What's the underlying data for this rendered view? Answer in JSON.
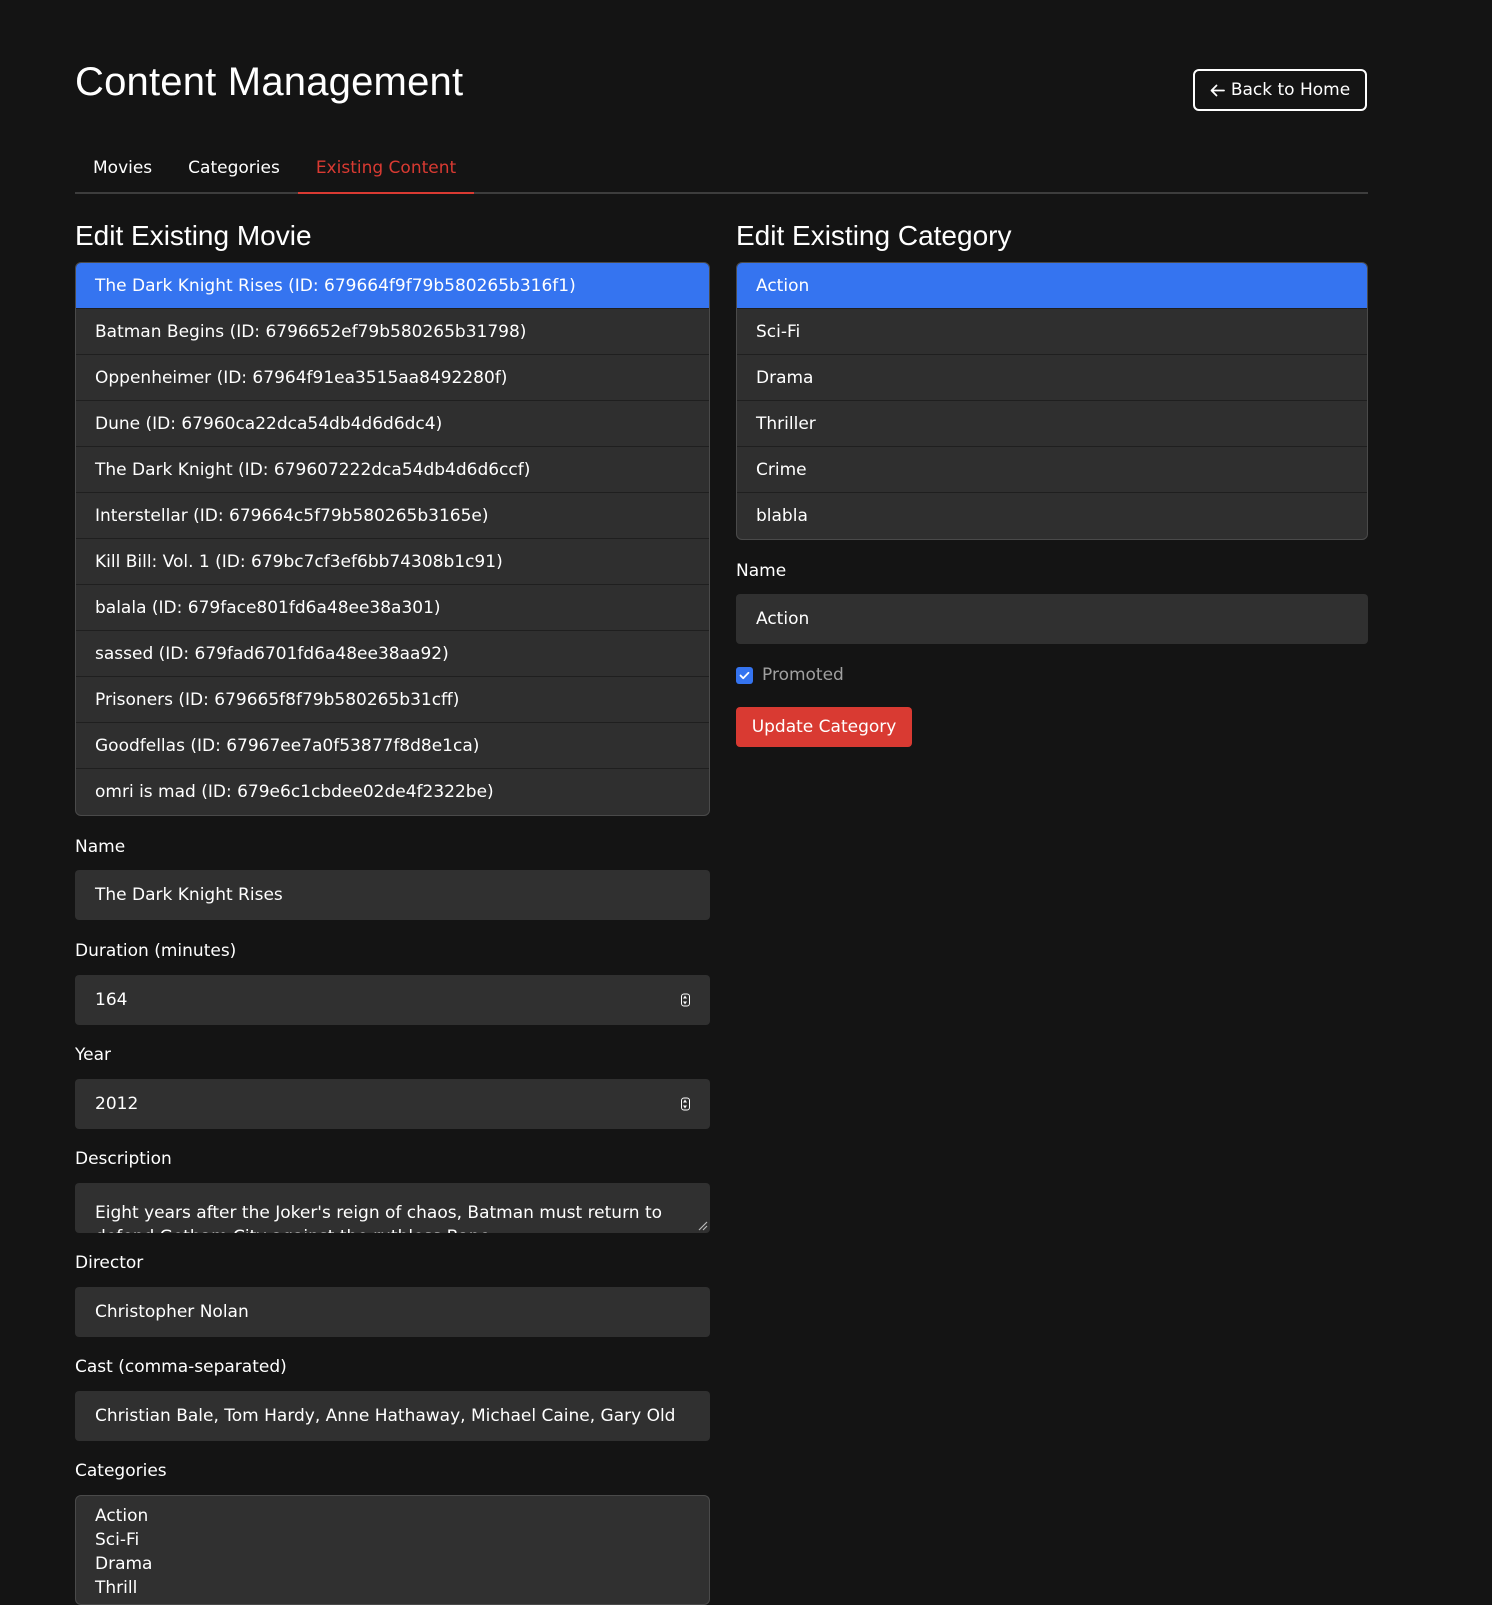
{
  "header": {
    "title": "Content Management",
    "back_label": "Back to Home",
    "back_icon": "arrow-left-icon"
  },
  "tabs": [
    {
      "label": "Movies",
      "active": false
    },
    {
      "label": "Categories",
      "active": false
    },
    {
      "label": "Existing Content",
      "active": true
    }
  ],
  "movie_editor": {
    "title": "Edit Existing Movie",
    "movies": [
      {
        "label": "The Dark Knight Rises (ID: 679664f9f79b580265b316f1)",
        "selected": true
      },
      {
        "label": "Batman Begins (ID: 6796652ef79b580265b31798)",
        "selected": false
      },
      {
        "label": "Oppenheimer (ID: 67964f91ea3515aa8492280f)",
        "selected": false
      },
      {
        "label": "Dune (ID: 67960ca22dca54db4d6d6dc4)",
        "selected": false
      },
      {
        "label": "The Dark Knight (ID: 679607222dca54db4d6d6ccf)",
        "selected": false
      },
      {
        "label": "Interstellar (ID: 679664c5f79b580265b3165e)",
        "selected": false
      },
      {
        "label": "Kill Bill: Vol. 1 (ID: 679bc7cf3ef6bb74308b1c91)",
        "selected": false
      },
      {
        "label": "balala (ID: 679face801fd6a48ee38a301)",
        "selected": false
      },
      {
        "label": "sassed (ID: 679fad6701fd6a48ee38aa92)",
        "selected": false
      },
      {
        "label": "Prisoners (ID: 679665f8f79b580265b31cff)",
        "selected": false
      },
      {
        "label": "Goodfellas (ID: 67967ee7a0f53877f8d8e1ca)",
        "selected": false
      },
      {
        "label": "omri is mad (ID: 679e6c1cbdee02de4f2322be)",
        "selected": false
      }
    ],
    "name_label": "Name",
    "name_value": "The Dark Knight Rises",
    "duration_label": "Duration (minutes)",
    "duration_value": "164",
    "year_label": "Year",
    "year_value": "2012",
    "description_label": "Description",
    "description_value": "Eight years after the Joker's reign of chaos, Batman must return to defend Gotham City against the ruthless Bane.",
    "director_label": "Director",
    "director_value": "Christopher Nolan",
    "cast_label": "Cast (comma-separated)",
    "cast_value": "Christian Bale, Tom Hardy, Anne Hathaway, Michael Caine, Gary Old",
    "categories_label": "Categories",
    "categories_options": [
      "Action",
      "Sci-Fi",
      "Drama",
      "Thrill"
    ]
  },
  "category_editor": {
    "title": "Edit Existing Category",
    "categories": [
      {
        "label": "Action",
        "selected": true
      },
      {
        "label": "Sci-Fi",
        "selected": false
      },
      {
        "label": "Drama",
        "selected": false
      },
      {
        "label": "Thriller",
        "selected": false
      },
      {
        "label": "Crime",
        "selected": false
      },
      {
        "label": "blabla",
        "selected": false
      }
    ],
    "name_label": "Name",
    "name_value": "Action",
    "promoted_label": "Promoted",
    "promoted_checked": true,
    "update_label": "Update Category"
  },
  "colors": {
    "background": "#141414",
    "accent_blue": "#3574f0",
    "accent_red": "#d93a32",
    "field_bg": "#303030"
  }
}
